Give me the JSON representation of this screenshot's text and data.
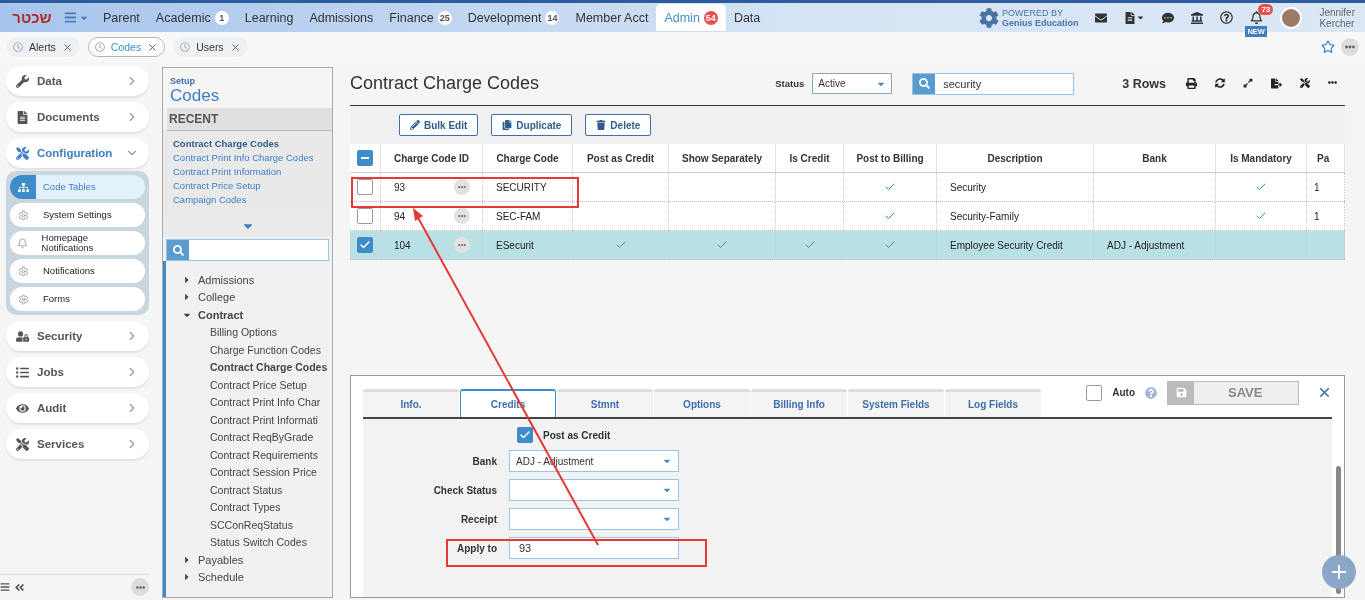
{
  "nav": {
    "logo_text": "שכטר",
    "items": [
      {
        "label": "Parent",
        "selected": false
      },
      {
        "label": "Academic",
        "badge": "1",
        "selected": false
      },
      {
        "label": "Learning",
        "selected": false
      },
      {
        "label": "Admissions",
        "selected": false
      },
      {
        "label": "Finance",
        "badge": "25",
        "selected": false
      },
      {
        "label": "Development",
        "badge": "14",
        "selected": false
      },
      {
        "label": "Member Acct",
        "selected": false
      },
      {
        "label": "Admin",
        "badge": "54",
        "selected": true
      },
      {
        "label": "Data",
        "selected": false
      }
    ],
    "powered_by": "POWERED BY",
    "powered_name": "Genius Education",
    "notification_count": "73",
    "new_tag": "NEW",
    "user_first": "Jennifer",
    "user_last": "Kercher"
  },
  "open_tabs": [
    {
      "label": "Alerts",
      "selected": false
    },
    {
      "label": "Codes",
      "selected": true
    },
    {
      "label": "Users",
      "selected": false
    }
  ],
  "sidebar": {
    "sections": [
      {
        "label": "Data",
        "expanded": false
      },
      {
        "label": "Documents",
        "expanded": false
      },
      {
        "label": "Configuration",
        "expanded": true,
        "children": [
          {
            "label": "Code Tables",
            "selected": true
          },
          {
            "label": "System Settings",
            "selected": false
          },
          {
            "label": "Homepage Notifications",
            "selected": false
          },
          {
            "label": "Notifications",
            "selected": false
          },
          {
            "label": "Forms",
            "selected": false
          }
        ]
      },
      {
        "label": "Security",
        "expanded": false
      },
      {
        "label": "Jobs",
        "expanded": false
      },
      {
        "label": "Audit",
        "expanded": false
      },
      {
        "label": "Services",
        "expanded": false
      }
    ]
  },
  "setup": {
    "section": "Setup",
    "title": "Codes",
    "recent_heading": "RECENT",
    "recent": [
      {
        "label": "Contract Charge Codes",
        "selected": true
      },
      {
        "label": "Contract Print Info Charge Codes",
        "selected": false
      },
      {
        "label": "Contract Print Information",
        "selected": false
      },
      {
        "label": "Contract Price Setup",
        "selected": false
      },
      {
        "label": "Campaign Codes",
        "selected": false
      }
    ],
    "tree": [
      {
        "label": "Admissions",
        "expanded": false
      },
      {
        "label": "College",
        "expanded": false
      },
      {
        "label": "Contract",
        "expanded": true,
        "children": [
          {
            "label": "Billing Options",
            "selected": false
          },
          {
            "label": "Charge Function Codes",
            "selected": false
          },
          {
            "label": "Contract Charge Codes",
            "selected": true
          },
          {
            "label": "Contract Price Setup",
            "selected": false
          },
          {
            "label": "Contract Print Info Char",
            "selected": false
          },
          {
            "label": "Contract Print Informati",
            "selected": false
          },
          {
            "label": "Contract ReqByGrade",
            "selected": false
          },
          {
            "label": "Contract Requirements",
            "selected": false
          },
          {
            "label": "Contract Session Price",
            "selected": false
          },
          {
            "label": "Contract Status",
            "selected": false
          },
          {
            "label": "Contract Types",
            "selected": false
          },
          {
            "label": "SCConReqStatus",
            "selected": false
          },
          {
            "label": "Status Switch Codes",
            "selected": false
          }
        ]
      },
      {
        "label": "Payables",
        "expanded": false
      },
      {
        "label": "Schedule",
        "expanded": false
      }
    ]
  },
  "main": {
    "title": "Contract Charge Codes",
    "status_label": "Status",
    "status_value": "Active",
    "search_value": "security",
    "row_count": "3 Rows",
    "actions": [
      "Bulk Edit",
      "Duplicate",
      "Delete"
    ]
  },
  "table": {
    "select_all_partial": true,
    "columns": [
      "Charge Code ID",
      "Charge Code",
      "Post as Credit",
      "Show Separately",
      "Is Credit",
      "Post to Billing",
      "Description",
      "Bank",
      "Is Mandatory",
      "Pa"
    ],
    "rows": [
      {
        "selected": false,
        "id": "93",
        "code": "SECURITY",
        "post_as_credit": false,
        "show_separately": false,
        "is_credit": false,
        "post_to_billing": true,
        "description": "Security",
        "is_mandatory": true,
        "column_10": "1"
      },
      {
        "selected": false,
        "id": "94",
        "code": "SEC-FAM",
        "post_as_credit": false,
        "show_separately": false,
        "is_credit": false,
        "post_to_billing": true,
        "description": "Security-Family",
        "is_mandatory": true,
        "column_10": "1"
      },
      {
        "selected": true,
        "id": "104",
        "code": "ESecurit",
        "post_as_credit": true,
        "show_separately": true,
        "is_credit": true,
        "post_to_billing": true,
        "description": "Employee Security Credit",
        "bank": "ADJ - Adjustment",
        "is_mandatory": false
      }
    ]
  },
  "detail": {
    "tabs": [
      {
        "label": "Info.",
        "selected": false
      },
      {
        "label": "Credits",
        "selected": true
      },
      {
        "label": "Stmnt",
        "selected": false
      },
      {
        "label": "Options",
        "selected": false
      },
      {
        "label": "Billing Info",
        "selected": false
      },
      {
        "label": "System Fields",
        "selected": false
      },
      {
        "label": "Log Fields",
        "selected": false
      }
    ],
    "auto_label": "Auto",
    "auto_checked": false,
    "save_label": "SAVE",
    "post_as_credit_label": "Post as Credit",
    "post_as_credit": true,
    "fields": [
      {
        "label": "Bank",
        "kind": "select",
        "value": "ADJ - Adjustment"
      },
      {
        "label": "Check Status",
        "kind": "select"
      },
      {
        "label": "Receipt",
        "kind": "select"
      },
      {
        "label": "Apply to",
        "kind": "input",
        "value": "93"
      }
    ]
  }
}
